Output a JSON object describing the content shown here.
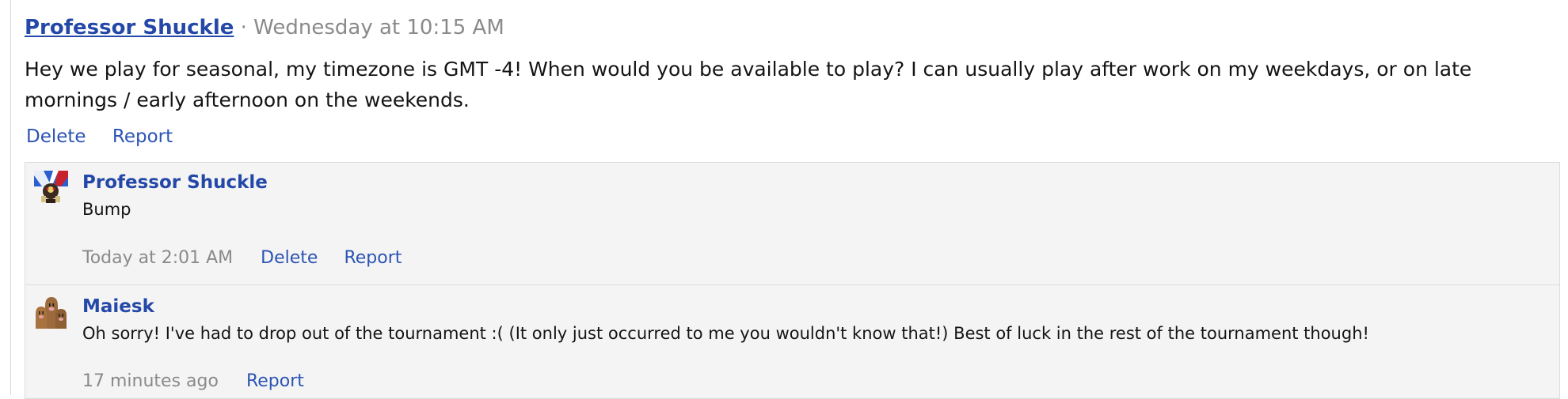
{
  "post": {
    "author": "Professor Shuckle",
    "separator": "·",
    "timestamp": "Wednesday at 10:15 AM",
    "body": "Hey we play for seasonal, my timezone is GMT -4! When would you be available to play? I can usually play after work on my weekdays, or on late mornings / early afternoon on the weekends.",
    "actions": {
      "delete": "Delete",
      "report": "Report"
    }
  },
  "comments": [
    {
      "author": "Professor Shuckle",
      "avatar_icon": "shuckle-avatar-icon",
      "text": "Bump",
      "timestamp": "Today at 2:01 AM",
      "delete": "Delete",
      "report": "Report"
    },
    {
      "author": "Maiesk",
      "avatar_icon": "dugtrio-avatar-icon",
      "text": "Oh sorry! I've had to drop out of the tournament :( (It only just occurred to me you wouldn't know that!) Best of luck in the rest of the tournament though!",
      "timestamp": "17 minutes ago",
      "report": "Report"
    }
  ],
  "colors": {
    "link": "#2c54b4",
    "author": "#2448a8",
    "muted": "#8a8a8a",
    "comment_bg": "#f4f4f4",
    "border": "#dcdcdc"
  }
}
